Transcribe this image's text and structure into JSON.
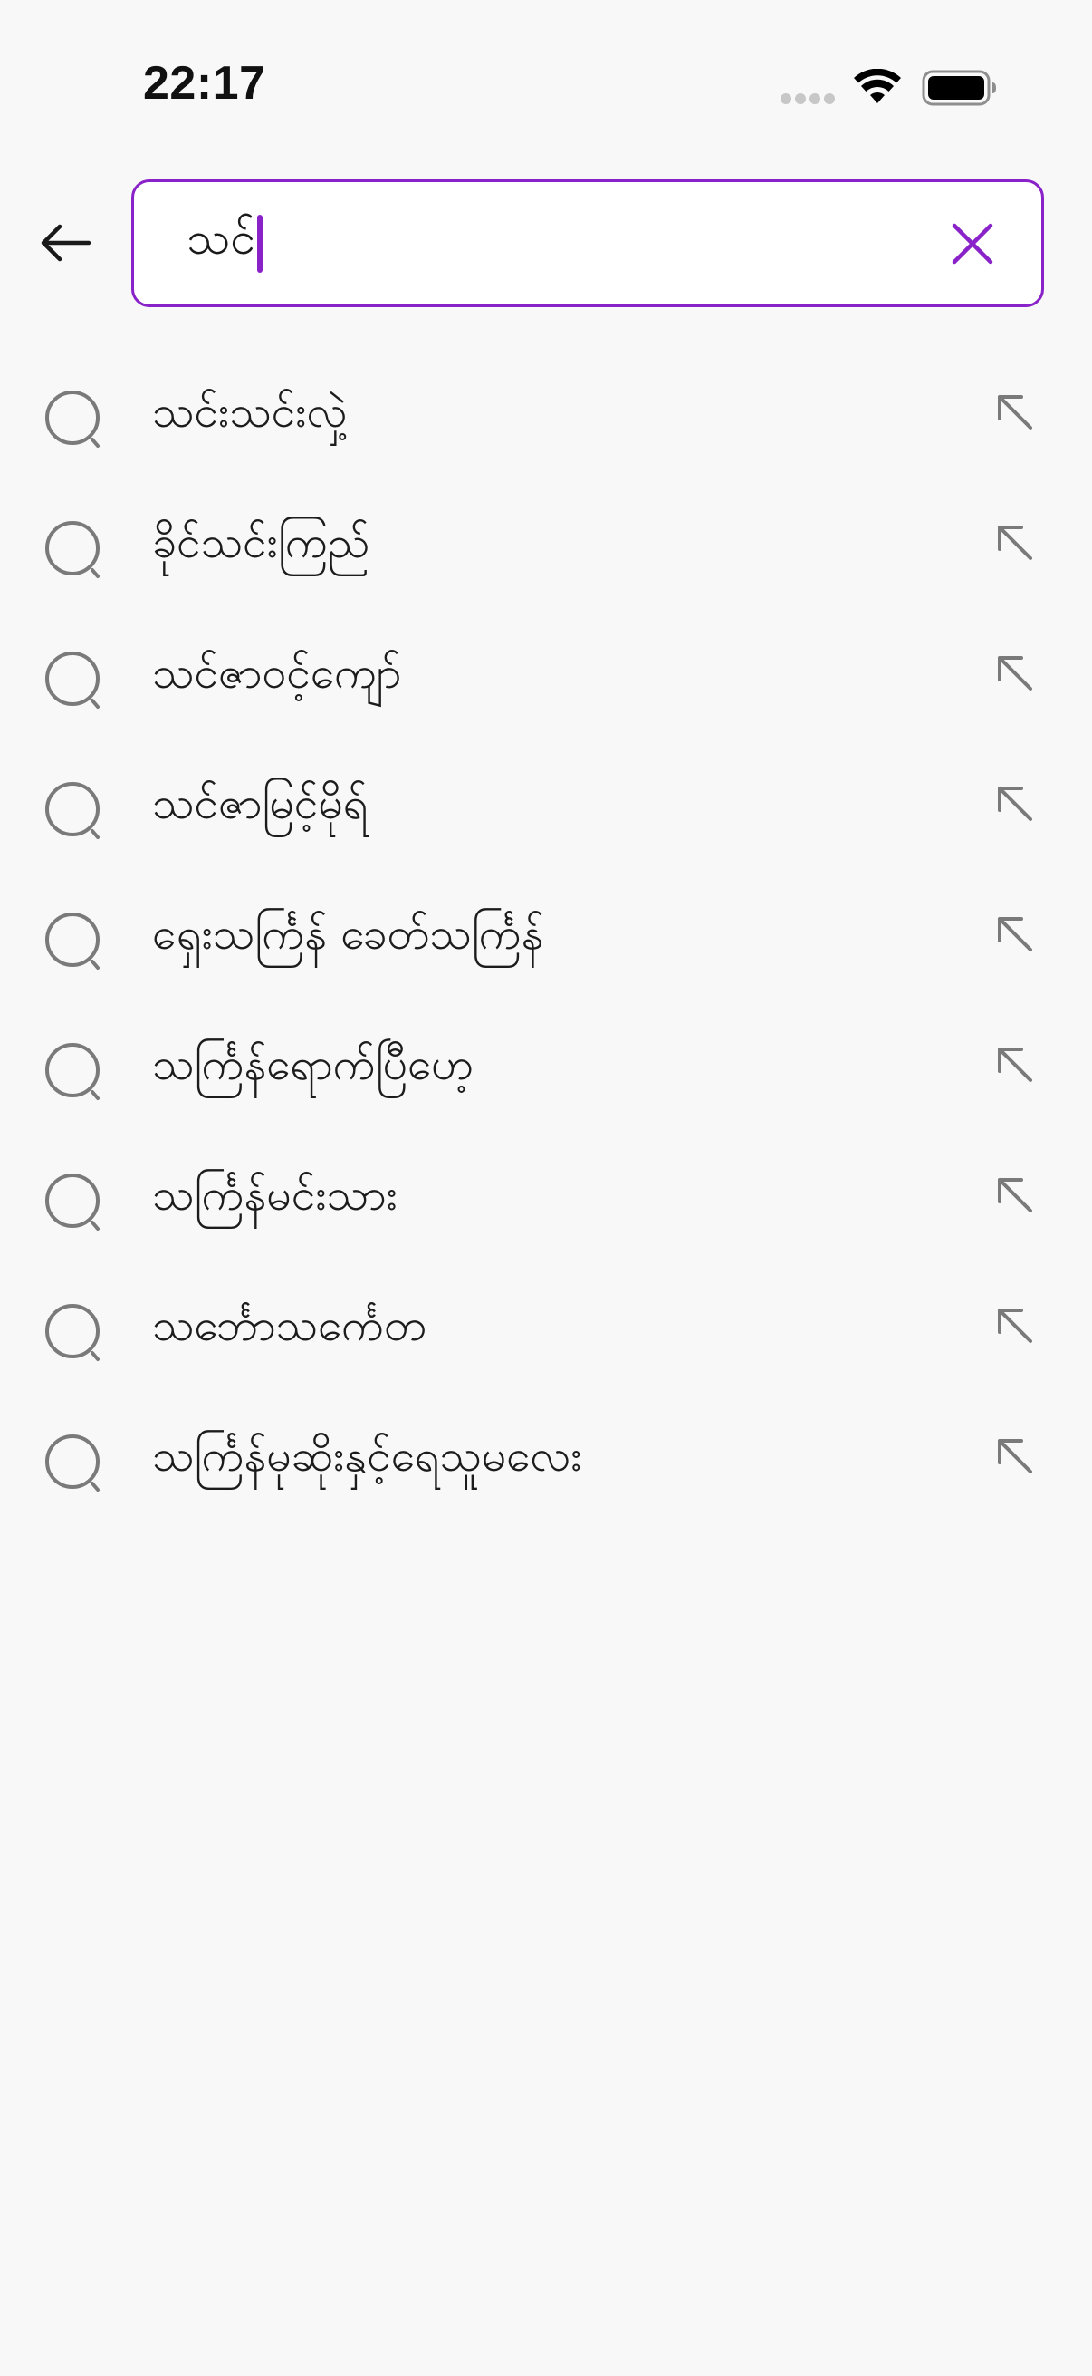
{
  "status_bar": {
    "time": "22:17"
  },
  "search": {
    "query": "သင်",
    "accent_color": "#8a22c9",
    "back_icon": "arrow-left-icon",
    "clear_icon": "close-icon"
  },
  "suggestions": [
    {
      "label": "သင်းသင်းလှဲ့"
    },
    {
      "label": "ခိုင်သင်းကြည်"
    },
    {
      "label": "သင်ဇာဝင့်ကျော်"
    },
    {
      "label": "သင်ဇာမြင့်မိုရ်"
    },
    {
      "label": "ရှေးသင်္ကြန် ခေတ်သင်္ကြန်"
    },
    {
      "label": "သင်္ကြန်ရောက်ပြီဟေ့"
    },
    {
      "label": "သင်္ကြန်မင်းသား"
    },
    {
      "label": "သင်္ဘောသင်္ကေတ"
    },
    {
      "label": "သင်္ကြန်မုဆိုးနှင့်ရေသူမလေး"
    }
  ],
  "icons": {
    "suggestion_leading": "search-icon",
    "suggestion_trailing": "arrow-up-left-icon"
  }
}
